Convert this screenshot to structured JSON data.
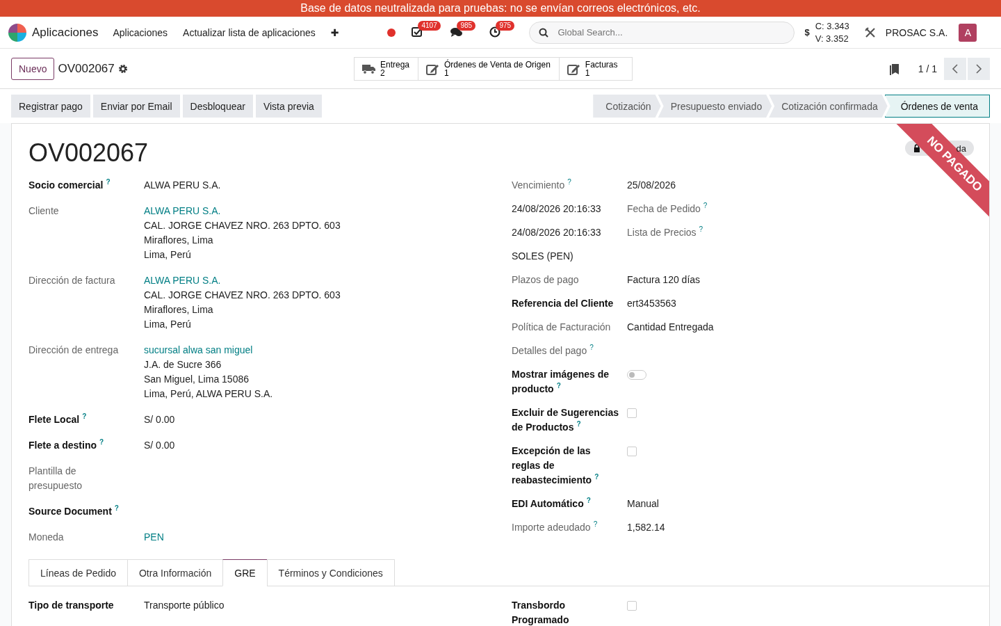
{
  "banner": "Base de datos neutralizada para pruebas: no se envían correos electrónicos, etc.",
  "navbar": {
    "app": "Aplicaciones",
    "menu": [
      "Aplicaciones",
      "Actualizar lista de aplicaciones"
    ],
    "plus": "✚",
    "systray": [
      {
        "kind": "check",
        "count": "4107"
      },
      {
        "kind": "chat",
        "count": "985"
      },
      {
        "kind": "clock",
        "count": "975"
      }
    ],
    "search": {
      "placeholder": "Global Search..."
    },
    "currency": {
      "symbol": "$",
      "lines": [
        "C: 3.343",
        "V: 3.352"
      ]
    },
    "company": "PROSAC S.A.",
    "avatar": "A"
  },
  "control_panel": {
    "new_button": "Nuevo",
    "record": "OV002067",
    "smart_buttons": [
      {
        "kind": "truck",
        "label": "Entrega",
        "count": "2"
      },
      {
        "kind": "edit",
        "label": "Órdenes de Venta de Origen",
        "count": "1"
      },
      {
        "kind": "edit",
        "label": "Facturas",
        "count": "1"
      }
    ],
    "pager": "1 / 1"
  },
  "actions": [
    "Registrar pago",
    "Enviar por Email",
    "Desbloquear",
    "Vista previa"
  ],
  "stages": [
    {
      "label": "Cotización",
      "selected": false
    },
    {
      "label": "Presupuesto enviado",
      "selected": false
    },
    {
      "label": "Cotización confirmada",
      "selected": false
    },
    {
      "label": "Órdenes de venta",
      "selected": true
    }
  ],
  "sheet": {
    "title": "OV002067",
    "badge": "da",
    "ribbon": "NO PAGADO",
    "left": [
      {
        "label": {
          "lines": [
            "Socio comercial"
          ],
          "kind": "required",
          "help": "?"
        },
        "value": {
          "kind": "text",
          "lines": [
            "ALWA PERU S.A."
          ]
        }
      },
      {
        "label": {
          "lines": [
            "Cliente"
          ],
          "kind": "readonly"
        },
        "value": {
          "kind": "address",
          "lines": [
            "ALWA PERU S.A.",
            "CAL. JORGE CHAVEZ NRO. 263 DPTO. 603",
            "Miraflores, Lima",
            "Lima, Perú"
          ]
        }
      },
      {
        "label": {
          "lines": [
            "Dirección de factura"
          ],
          "kind": "readonly"
        },
        "value": {
          "kind": "address",
          "lines": [
            "ALWA PERU S.A.",
            "CAL. JORGE CHAVEZ NRO. 263 DPTO. 603",
            "Miraflores, Lima",
            "Lima, Perú"
          ]
        }
      },
      {
        "label": {
          "lines": [
            "Dirección de entrega"
          ],
          "kind": "readonly"
        },
        "value": {
          "kind": "address",
          "lines": [
            "sucursal alwa san miguel",
            "J.A. de Sucre 366",
            "San Miguel, Lima 15086",
            "Lima, Perú, ALWA PERU S.A."
          ]
        }
      },
      {
        "label": {
          "lines": [
            "Flete Local"
          ],
          "kind": "required",
          "help": "?"
        },
        "value": {
          "kind": "text",
          "lines": [
            "S/ 0.00"
          ]
        }
      },
      {
        "label": {
          "lines": [
            "Flete a destino"
          ],
          "kind": "required",
          "help": "?"
        },
        "value": {
          "kind": "text",
          "lines": [
            "S/ 0.00"
          ]
        }
      },
      {
        "label": {
          "lines": [
            "Plantilla de",
            "presupuesto"
          ],
          "kind": "readonly"
        },
        "value": {
          "kind": "empty"
        }
      },
      {
        "label": {
          "lines": [
            "Source Document"
          ],
          "kind": "required",
          "help": "?"
        },
        "value": {
          "kind": "empty"
        }
      },
      {
        "label": {
          "lines": [
            "Moneda"
          ],
          "kind": "readonly"
        },
        "value": {
          "kind": "link",
          "lines": [
            "PEN"
          ]
        }
      }
    ],
    "right": [
      {
        "label": {
          "lines": [
            "Vencimiento"
          ],
          "kind": "readonly",
          "help": "?"
        },
        "value": {
          "kind": "text",
          "lines": [
            "25/08/2026"
          ]
        }
      },
      {
        "label": {
          "lines": [
            "24/08/2026 20:16:33"
          ],
          "kind": "value"
        },
        "value": {
          "kind": "caption",
          "lines": [
            "Fecha de Pedido"
          ],
          "help": "?"
        }
      },
      {
        "label": {
          "lines": [
            "24/08/2026 20:16:33"
          ],
          "kind": "value"
        },
        "value": {
          "kind": "caption",
          "lines": [
            "Lista de Precios"
          ],
          "help": "?"
        }
      },
      {
        "label": {
          "lines": [
            "SOLES (PEN)"
          ],
          "kind": "value"
        },
        "value": {
          "kind": "empty"
        }
      },
      {
        "label": {
          "lines": [
            "Plazos de pago"
          ],
          "kind": "readonly"
        },
        "value": {
          "kind": "text",
          "lines": [
            "Factura 120 días"
          ]
        }
      },
      {
        "label": {
          "lines": [
            "Referencia del Cliente"
          ],
          "kind": "required"
        },
        "value": {
          "kind": "text",
          "lines": [
            "ert3453563"
          ]
        }
      },
      {
        "label": {
          "lines": [
            "Política de Facturación"
          ],
          "kind": "readonly"
        },
        "value": {
          "kind": "text",
          "lines": [
            "Cantidad Entregada"
          ]
        }
      },
      {
        "label": {
          "lines": [
            "Detalles del pago"
          ],
          "kind": "readonly",
          "help": "?"
        },
        "value": {
          "kind": "empty"
        }
      },
      {
        "label": {
          "lines": [
            "Mostrar imágenes de",
            "producto"
          ],
          "kind": "required",
          "help": "?"
        },
        "value": {
          "kind": "toggle",
          "on": false
        }
      },
      {
        "label": {
          "lines": [
            "Excluir de Sugerencias",
            "de Productos"
          ],
          "kind": "required",
          "help": "?"
        },
        "value": {
          "kind": "checkbox",
          "checked": false
        }
      },
      {
        "label": {
          "lines": [
            "Excepción de las",
            "reglas de",
            "reabastecimiento"
          ],
          "kind": "required",
          "help": "?"
        },
        "value": {
          "kind": "checkbox",
          "checked": false
        }
      },
      {
        "label": {
          "lines": [
            "EDI Automático"
          ],
          "kind": "required",
          "help": "?"
        },
        "value": {
          "kind": "text",
          "lines": [
            "Manual"
          ]
        }
      },
      {
        "label": {
          "lines": [
            "Importe adeudado"
          ],
          "kind": "readonly",
          "help": "?"
        },
        "value": {
          "kind": "text",
          "lines": [
            "1,582.14"
          ]
        }
      }
    ],
    "tabs": [
      {
        "label": "Líneas de Pedido",
        "selected": false
      },
      {
        "label": "Otra Información",
        "selected": false
      },
      {
        "label": "GRE",
        "selected": true
      },
      {
        "label": "Términos y Condiciones",
        "selected": false
      }
    ],
    "tab_left": [
      {
        "label": {
          "lines": [
            "Tipo de transporte"
          ],
          "kind": "required"
        },
        "value": {
          "kind": "text",
          "lines": [
            "Transporte público"
          ]
        }
      }
    ],
    "tab_right": [
      {
        "label": {
          "lines": [
            "Transbordo",
            "Programado"
          ],
          "kind": "required"
        },
        "value": {
          "kind": "checkbox",
          "checked": false
        }
      }
    ]
  }
}
